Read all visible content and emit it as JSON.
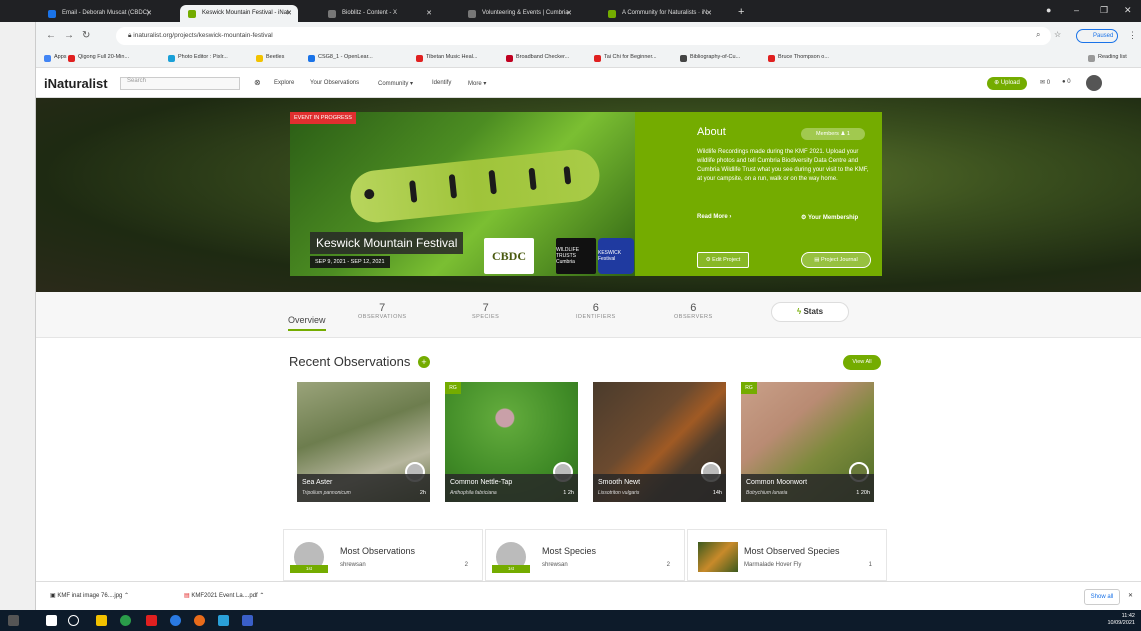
{
  "browser": {
    "tabs": [
      {
        "label": "Email - Deborah Muscat (CBDC)",
        "color": "#1a73e8"
      },
      {
        "label": "Keswick Mountain Festival - iNat",
        "color": "#74ac00",
        "active": true
      },
      {
        "label": "Bioblitz - Content - X",
        "color": "#555555"
      },
      {
        "label": "Volunteering & Events | Cumbria",
        "color": "#555555"
      },
      {
        "label": "A Community for Naturalists · iN",
        "color": "#74ac00"
      }
    ],
    "url": "inaturalist.org/projects/keswick-mountain-festival",
    "profile_status": "Paused",
    "reading_list": "Reading list",
    "bookmarks": [
      {
        "label": "Apps",
        "color": "#4285f4"
      },
      {
        "label": "Qigong Full 20-Min...",
        "color": "#e02020"
      },
      {
        "label": "Photo Editor : Pixlr...",
        "color": "#1aa0d8"
      },
      {
        "label": "Beetles",
        "color": "#f2c200"
      },
      {
        "label": "CSG8_1 - OpenLear...",
        "color": "#1a73e8"
      },
      {
        "label": "Tibetan Music Heal...",
        "color": "#e02020"
      },
      {
        "label": "Broadband Checker...",
        "color": "#c00020"
      },
      {
        "label": "Tai Chi for Beginner...",
        "color": "#e02020"
      },
      {
        "label": "Bibliography-of-Cu...",
        "color": "#444444"
      },
      {
        "label": "Bruce Thompson o...",
        "color": "#e02020"
      }
    ]
  },
  "header": {
    "logo": "iNaturalist",
    "search_placeholder": "Search",
    "menu": [
      "Explore",
      "Your Observations",
      "Community ▾",
      "Identify",
      "More ▾"
    ],
    "upload_label": "Upload",
    "messages": "0",
    "notifications": "0"
  },
  "banner": {
    "badge": "EVENT IN PROGRESS",
    "title": "Keswick Mountain Festival",
    "dates": "SEP 9, 2021 - SEP 12, 2021",
    "about_heading": "About",
    "members_label": "Members",
    "members_count": "1",
    "about_text": "Wildlife Recordings made during the KMF 2021. Upload your wildlife photos and tell Cumbria Biodiversity Data Centre and Cumbria Wildlife Trust what you see during your visit to the KMF, at your campsite, on a run, walk or on the way home.",
    "read_more": "Read More ›",
    "your_membership": "Your Membership",
    "edit_project": "Edit Project",
    "project_journal": "Project Journal",
    "logos": {
      "cbdc": "CBDC",
      "cwt": "WILDLIFE TRUSTS Cumbria",
      "kmf": "KESWICK Festival"
    }
  },
  "stats": {
    "overview": "Overview",
    "items": [
      {
        "count": "7",
        "label": "OBSERVATIONS"
      },
      {
        "count": "7",
        "label": "SPECIES"
      },
      {
        "count": "6",
        "label": "IDENTIFIERS"
      },
      {
        "count": "6",
        "label": "OBSERVERS"
      }
    ],
    "stats_button": "Stats"
  },
  "recent": {
    "title": "Recent Observations",
    "view_all": "View All",
    "items": [
      {
        "common": "Sea Aster",
        "scientific": "Tripolium pannonicum",
        "time": "2h",
        "rg": false
      },
      {
        "common": "Common Nettle-Tap",
        "scientific": "Anthophila fabriciana",
        "time": "1 2h",
        "rg": true
      },
      {
        "common": "Smooth Newt",
        "scientific": "Lissotriton vulgaris",
        "time": "14h",
        "rg": false
      },
      {
        "common": "Common Moonwort",
        "scientific": "Botrychium lunaria",
        "time": "1 20h",
        "rg": true
      }
    ],
    "rg_label": "RG"
  },
  "cards": [
    {
      "title": "Most Observations",
      "user": "shrewsan",
      "count": "2",
      "ribbon": "1st"
    },
    {
      "title": "Most Species",
      "user": "shrewsan",
      "count": "2",
      "ribbon": "1st"
    },
    {
      "title": "Most Observed Species",
      "user": "Marmalade Hover Fly",
      "count": "1",
      "ribbon": ""
    }
  ],
  "downloads": {
    "items": [
      "KMF inat image 76....jpg",
      "KMF2021 Event La....pdf"
    ],
    "show_all": "Show all"
  },
  "taskbar": {
    "time": "11:42",
    "date": "10/09/2021"
  }
}
